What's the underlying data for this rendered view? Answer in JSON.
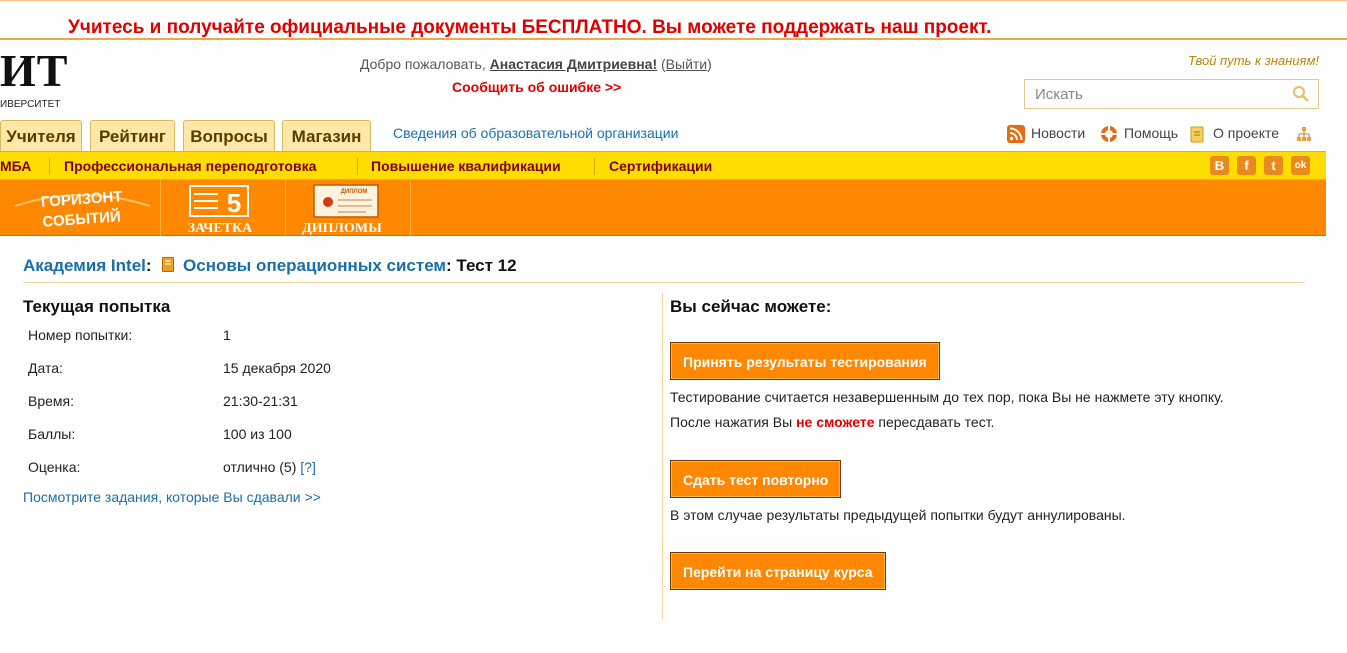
{
  "promo": {
    "text": "Учитесь и получайте официальные документы БЕСПЛАТНО. Вы можете поддержать наш проект."
  },
  "logo": {
    "main": "ИТ",
    "sub": "ИВЕРСИТЕТ"
  },
  "header": {
    "welcome_prefix": "Добро пожаловать,",
    "user_name": "Анастасия Дмитриевна!",
    "logout_open": "(",
    "logout_label": "Выйти",
    "logout_close": ")",
    "report_error": "Сообщить об ошибке >>",
    "slogan": "Твой путь к знаниям!",
    "search_placeholder": "Искать"
  },
  "tabs": [
    "Учителя",
    "Рейтинг",
    "Вопросы",
    "Магазин"
  ],
  "org_link": "Сведения об образовательной организации",
  "top_links": {
    "news": "Новости",
    "help": "Помощь",
    "about": "О проекте"
  },
  "yellow_menu": [
    "МБА",
    "Профессиональная переподготовка",
    "Повышение квалификации",
    "Сертификации"
  ],
  "social": [
    "В",
    "f",
    "t",
    "ok"
  ],
  "banners": {
    "horizon_line1": "ГОРИЗОНТ",
    "horizon_line2": "СОБЫТИЙ",
    "zachetka_grade": "5",
    "zachetka": "ЗАЧЕТКА",
    "diploma_badge": "ДИПЛОМ",
    "diplomy": "ДИПЛОМЫ"
  },
  "breadcrumb": {
    "academy": "Академия Intel",
    "sep1": ":",
    "course": "Основы операционных систем",
    "test": ": Тест 12"
  },
  "attempt": {
    "heading": "Текущая попытка",
    "rows": [
      {
        "label": "Номер попытки:",
        "value": "1"
      },
      {
        "label": "Дата:",
        "value": "15 декабря 2020"
      },
      {
        "label": "Время:",
        "value": "21:30-21:31"
      },
      {
        "label": "Баллы:",
        "value": "100 из 100"
      },
      {
        "label": "Оценка:",
        "value": "отлично (5)"
      }
    ],
    "grade_help": "[?]",
    "tasks_link": "Посмотрите задания, которые Вы сдавали >>"
  },
  "actions": {
    "heading": "Вы сейчас можете:",
    "accept_button": "Принять результаты тестирования",
    "accept_note1": "Тестирование считается незавершенным до тех пор, пока Вы не нажмете эту кнопку.",
    "accept_note2_prefix": "После нажатия Вы",
    "accept_note2_red": "не сможете",
    "accept_note2_suffix": "пересдавать тест.",
    "retake_button": "Сдать тест повторно",
    "retake_note": "В этом случае результаты предыдущей попытки будут аннулированы.",
    "course_button": "Перейти на страницу курса"
  },
  "colors": {
    "accent": "#ff8800",
    "menu_bar": "#ffdd00",
    "link": "#1a6fa8",
    "alert": "#e00000"
  }
}
